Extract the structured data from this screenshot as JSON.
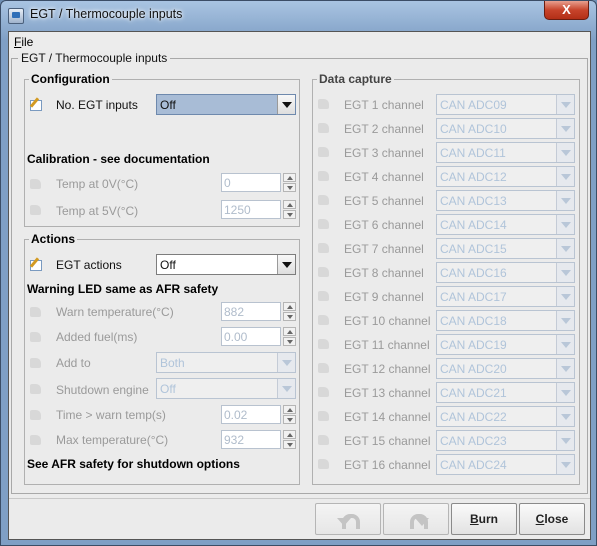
{
  "window": {
    "title": "EGT / Thermocouple inputs",
    "close_label": "X"
  },
  "menu": {
    "file_hotkey": "F",
    "file_rest": "ile"
  },
  "panel": {
    "title": "EGT / Thermocouple inputs"
  },
  "configuration": {
    "title": "Configuration",
    "no_egt_label": "No. EGT inputs",
    "no_egt_value": "Off",
    "calibration_title": "Calibration - see documentation",
    "temp0_label": "Temp at 0V(°C)",
    "temp0_value": "0",
    "temp5_label": "Temp at 5V(°C)",
    "temp5_value": "1250"
  },
  "actions": {
    "title": "Actions",
    "egt_actions_label": "EGT actions",
    "egt_actions_value": "Off",
    "warning_title": "Warning LED same as AFR safety",
    "warn_temp_label": "Warn temperature(°C)",
    "warn_temp_value": "882",
    "added_fuel_label": "Added fuel(ms)",
    "added_fuel_value": "0.00",
    "add_to_label": "Add to",
    "add_to_value": "Both",
    "shutdown_label": "Shutdown engine",
    "shutdown_value": "Off",
    "time_warn_label": "Time > warn temp(s)",
    "time_warn_value": "0.02",
    "max_temp_label": "Max temperature(°C)",
    "max_temp_value": "932",
    "footer": "See AFR safety for shutdown options"
  },
  "data_capture": {
    "title": "Data capture",
    "channels": [
      {
        "label": "EGT 1 channel",
        "value": "CAN ADC09"
      },
      {
        "label": "EGT 2 channel",
        "value": "CAN ADC10"
      },
      {
        "label": "EGT 3 channel",
        "value": "CAN ADC11"
      },
      {
        "label": "EGT 4 channel",
        "value": "CAN ADC12"
      },
      {
        "label": "EGT 5 channel",
        "value": "CAN ADC13"
      },
      {
        "label": "EGT 6 channel",
        "value": "CAN ADC14"
      },
      {
        "label": "EGT 7 channel",
        "value": "CAN ADC15"
      },
      {
        "label": "EGT 8 channel",
        "value": "CAN ADC16"
      },
      {
        "label": "EGT 9 channel",
        "value": "CAN ADC17"
      },
      {
        "label": "EGT 10 channel",
        "value": "CAN ADC18"
      },
      {
        "label": "EGT 11 channel",
        "value": "CAN ADC19"
      },
      {
        "label": "EGT 12 channel",
        "value": "CAN ADC20"
      },
      {
        "label": "EGT 13 channel",
        "value": "CAN ADC21"
      },
      {
        "label": "EGT 14 channel",
        "value": "CAN ADC22"
      },
      {
        "label": "EGT 15 channel",
        "value": "CAN ADC23"
      },
      {
        "label": "EGT 16 channel",
        "value": "CAN ADC24"
      }
    ]
  },
  "buttons": {
    "burn_hotkey": "B",
    "burn_rest": "urn",
    "close_hotkey": "C",
    "close_rest": "lose"
  },
  "colors": {
    "title_bar": "#7f9fc5",
    "close_button": "#c7442b",
    "selected_combo": "#a8bcd6"
  }
}
